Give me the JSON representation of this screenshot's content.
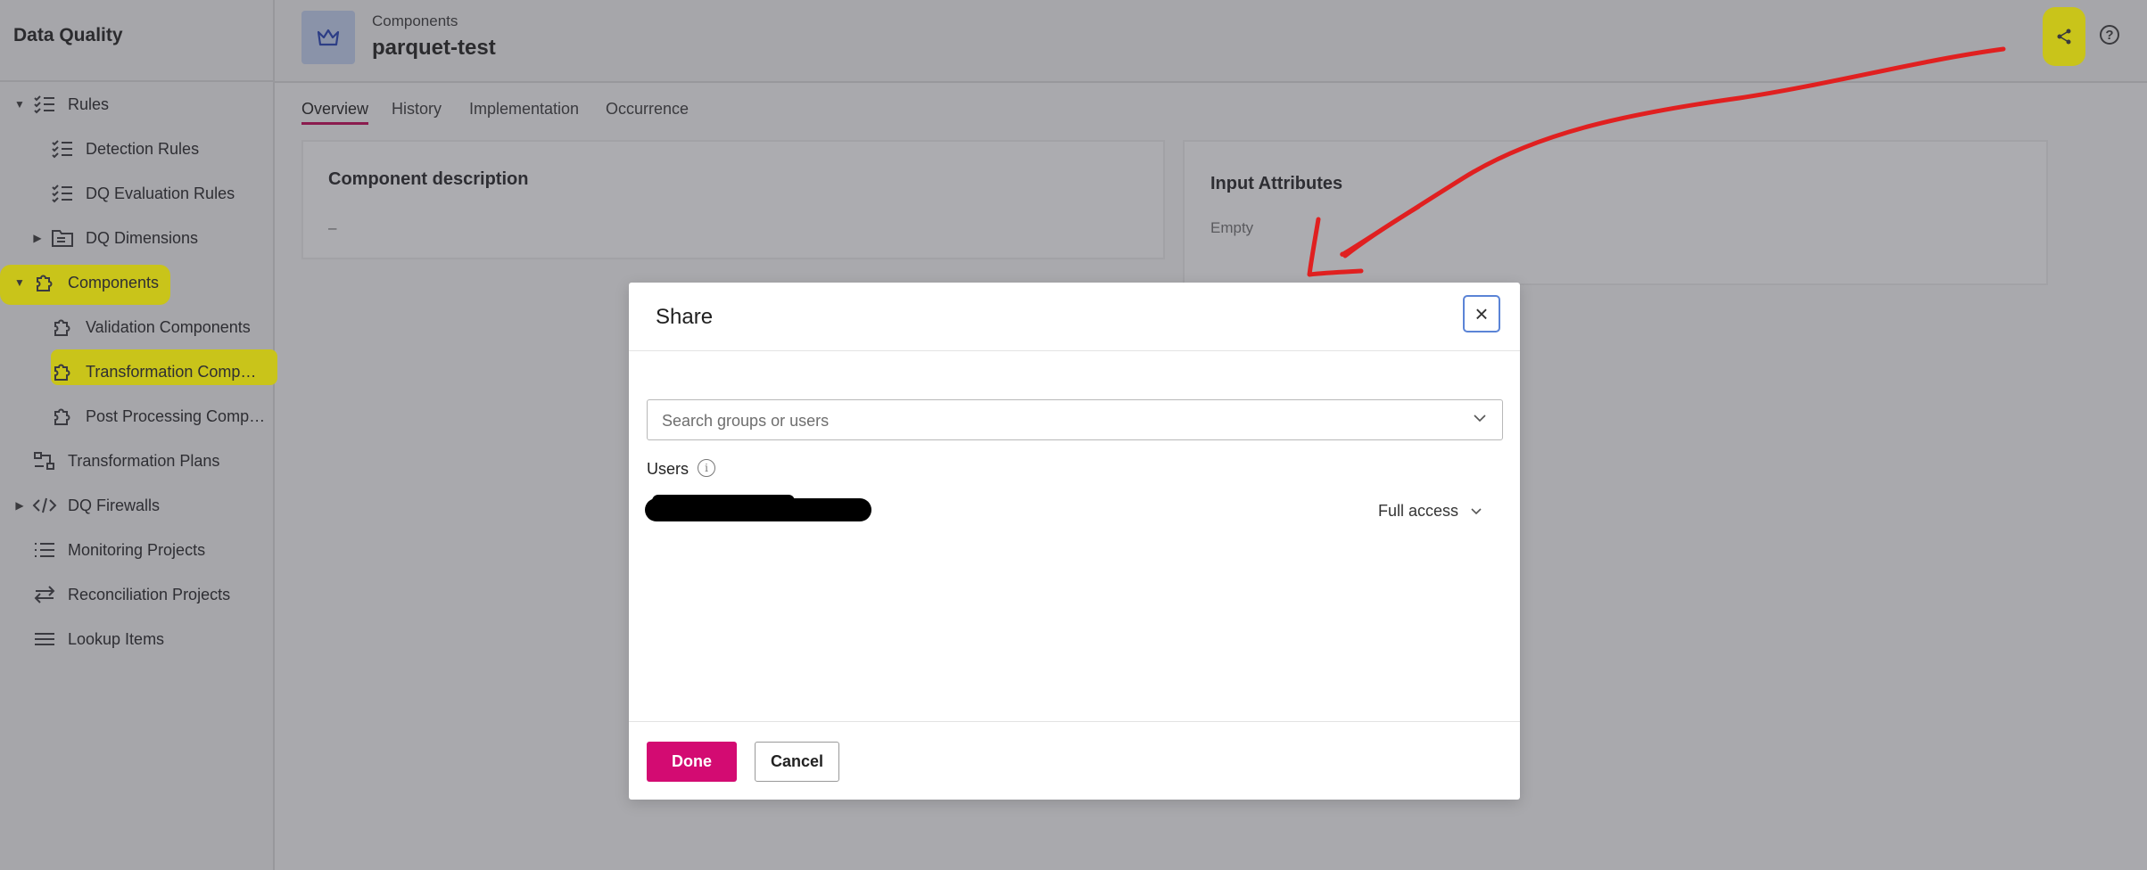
{
  "app": {
    "title": "Data Quality"
  },
  "sidebar": {
    "items": [
      {
        "label": "Rules",
        "icon": "checklist-icon",
        "caret": "▼"
      },
      {
        "label": "Detection Rules",
        "icon": "checklist-icon"
      },
      {
        "label": "DQ Evaluation Rules",
        "icon": "checklist-icon"
      },
      {
        "label": "DQ Dimensions",
        "icon": "folder-icon",
        "caret": "▶"
      },
      {
        "label": "Components",
        "icon": "puzzle-icon",
        "caret": "▼"
      },
      {
        "label": "Validation Components",
        "icon": "puzzle-icon"
      },
      {
        "label": "Transformation Comp…",
        "icon": "puzzle-icon"
      },
      {
        "label": "Post Processing Comp…",
        "icon": "puzzle-icon"
      },
      {
        "label": "Transformation Plans",
        "icon": "plans-icon"
      },
      {
        "label": "DQ Firewalls",
        "icon": "code-icon",
        "caret": "▶"
      },
      {
        "label": "Monitoring Projects",
        "icon": "list-icon"
      },
      {
        "label": "Reconciliation Projects",
        "icon": "swap-icon"
      },
      {
        "label": "Lookup Items",
        "icon": "lines-icon"
      }
    ]
  },
  "header": {
    "breadcrumb": "Components",
    "title": "parquet-test",
    "share_icon": "share-icon",
    "help_icon": "help-icon",
    "help_glyph": "?"
  },
  "tabs": [
    "Overview",
    "History",
    "Implementation",
    "Occurrence"
  ],
  "cards": {
    "description": {
      "title": "Component description",
      "value": "–"
    },
    "attributes": {
      "title": "Input Attributes",
      "value": "Empty"
    }
  },
  "modal": {
    "title": "Share",
    "close_glyph": "×",
    "search_placeholder": "Search groups or users",
    "users_label": "Users",
    "info_glyph": "i",
    "user_access": "Full access",
    "done_label": "Done",
    "cancel_label": "Cancel"
  },
  "colors": {
    "accent": "#d30b72",
    "highlight": "#c9c41a",
    "annotation": "#e02020",
    "focus": "#5b84d6"
  }
}
